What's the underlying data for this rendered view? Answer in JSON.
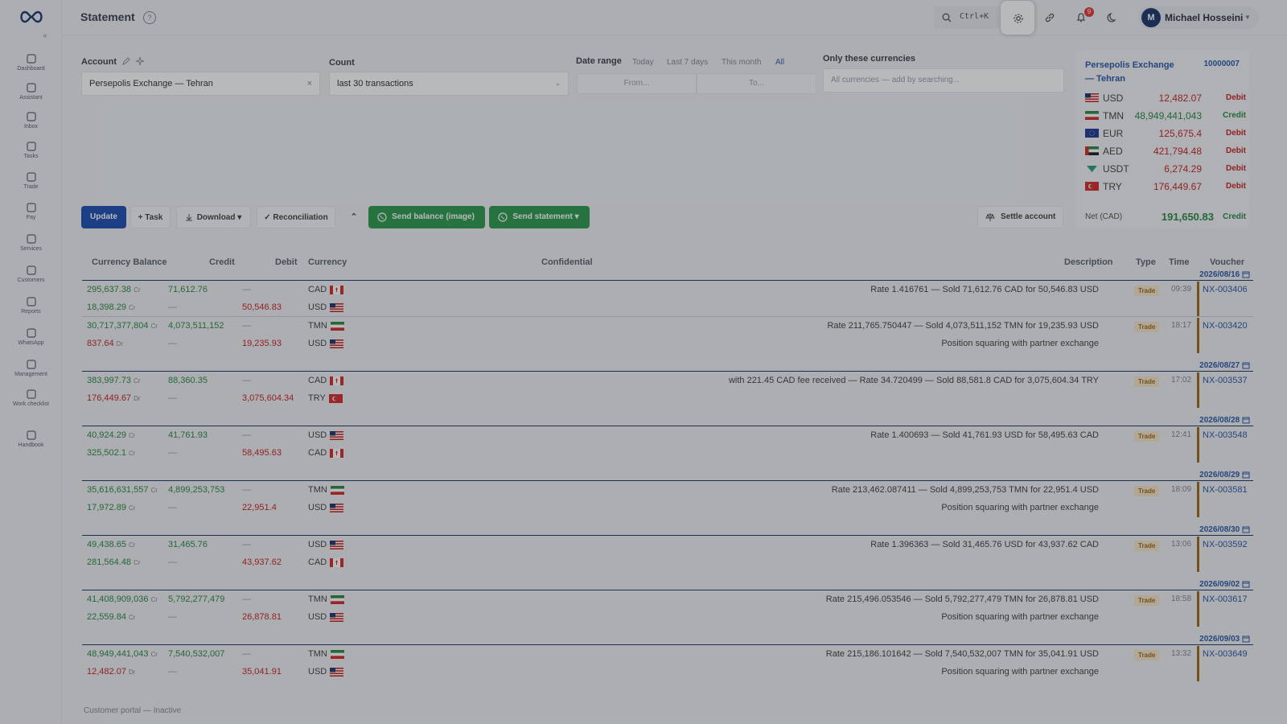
{
  "app": {
    "title": "Statement"
  },
  "topbar": {
    "search_shortcut": "Ctrl+K",
    "notif_count": "9",
    "user_initial": "M",
    "user_name": "Michael Hosseini"
  },
  "sidebar": {
    "items": [
      {
        "label": "Dashboard",
        "icon": "grid-icon"
      },
      {
        "label": "Assistant",
        "icon": "sparkle-icon"
      },
      {
        "label": "Inbox",
        "icon": "mail-icon"
      },
      {
        "label": "Tasks",
        "icon": "check-icon"
      },
      {
        "label": "Trade",
        "icon": "arrows-icon"
      },
      {
        "label": "Pay",
        "icon": "wallet-icon"
      },
      {
        "label": "Services",
        "icon": "bolt-icon"
      },
      {
        "label": "Customers",
        "icon": "users-icon"
      },
      {
        "label": "Reports",
        "icon": "file-icon"
      },
      {
        "label": "WhatsApp",
        "icon": "chat-icon"
      },
      {
        "label": "Management",
        "icon": "sliders-icon"
      },
      {
        "label": "Work checklist",
        "icon": "check-icon"
      },
      {
        "label": "Handbook",
        "icon": "book-icon"
      }
    ]
  },
  "filters": {
    "account_label": "Account",
    "account_value": "Persepolis Exchange — Tehran",
    "count_label": "Count",
    "count_value": "last 30 transactions",
    "date_range_label": "Date range",
    "date_options": [
      "Today",
      "Last 7 days",
      "This month",
      "All"
    ],
    "date_from_placeholder": "From...",
    "date_to_placeholder": "To...",
    "currencies_label": "Only these currencies",
    "currencies_placeholder": "All currencies — add by searching..."
  },
  "actions": {
    "update": "Update",
    "task": "+ Task",
    "download": "Download ▾",
    "reconciliation": "✓ Reconciliation",
    "send_balance": "Send balance (image)",
    "send_statement": "Send statement ▾",
    "settle": "Settle account"
  },
  "balance": {
    "account_name": "Persepolis Exchange — Tehran",
    "account_id": "10000007",
    "rows": [
      {
        "code": "USD",
        "amount": "12,482.07",
        "type": "Debit"
      },
      {
        "code": "TMN",
        "amount": "48,949,441,043",
        "type": "Credit"
      },
      {
        "code": "EUR",
        "amount": "125,675.4",
        "type": "Debit"
      },
      {
        "code": "AED",
        "amount": "421,794.48",
        "type": "Debit"
      },
      {
        "code": "USDT",
        "amount": "6,274.29",
        "type": "Debit"
      },
      {
        "code": "TRY",
        "amount": "176,449.67",
        "type": "Debit"
      }
    ],
    "net_label": "Net (CAD)",
    "net_value": "191,650.83",
    "net_type": "Credit"
  },
  "table": {
    "headers": [
      "Currency Balance",
      "Credit",
      "Debit",
      "Currency",
      "Confidential",
      "Description",
      "Type",
      "Time",
      "Voucher"
    ],
    "groups": [
      {
        "date": "2026/08/16",
        "time": "09:39",
        "voucher": "NX-003406",
        "type": "Trade",
        "rows": [
          {
            "bal": "295,637.38",
            "bs": "Cr",
            "credit": "71,612.76",
            "debit": "—",
            "cur": "CAD",
            "desc": "Rate 1.416761 — Sold 71,612.76 CAD for 50,546.83 USD"
          },
          {
            "bal": "18,398.29",
            "bs": "Cr",
            "credit": "—",
            "debit": "50,546.83",
            "cur": "USD",
            "desc": ""
          }
        ]
      },
      {
        "date": "",
        "time": "18:17",
        "voucher": "NX-003420",
        "type": "Trade",
        "rows": [
          {
            "bal": "30,717,377,804",
            "bs": "Cr",
            "credit": "4,073,511,152",
            "debit": "—",
            "cur": "TMN",
            "desc": "Rate 211,765.750447 — Sold 4,073,511,152 TMN for 19,235.93 USD"
          },
          {
            "bal": "837.64",
            "bs": "Dr",
            "credit": "—",
            "debit": "19,235.93",
            "cur": "USD",
            "desc": "Position squaring with partner exchange"
          }
        ]
      },
      {
        "date": "2026/08/27",
        "time": "17:02",
        "voucher": "NX-003537",
        "type": "Trade",
        "rows": [
          {
            "bal": "383,997.73",
            "bs": "Cr",
            "credit": "88,360.35",
            "debit": "—",
            "cur": "CAD",
            "desc": "with 221.45 CAD fee received — Rate 34.720499 — Sold 88,581.8 CAD for 3,075,604.34 TRY"
          },
          {
            "bal": "176,449.67",
            "bs": "Dr",
            "credit": "—",
            "debit": "3,075,604.34",
            "cur": "TRY",
            "desc": ""
          }
        ]
      },
      {
        "date": "2026/08/28",
        "time": "12:41",
        "voucher": "NX-003548",
        "type": "Trade",
        "rows": [
          {
            "bal": "40,924.29",
            "bs": "Cr",
            "credit": "41,761.93",
            "debit": "—",
            "cur": "USD",
            "desc": "Rate 1.400693 — Sold 41,761.93 USD for 58,495.63 CAD"
          },
          {
            "bal": "325,502.1",
            "bs": "Cr",
            "credit": "—",
            "debit": "58,495.63",
            "cur": "CAD",
            "desc": ""
          }
        ]
      },
      {
        "date": "2026/08/29",
        "time": "18:09",
        "voucher": "NX-003581",
        "type": "Trade",
        "rows": [
          {
            "bal": "35,616,631,557",
            "bs": "Cr",
            "credit": "4,899,253,753",
            "debit": "—",
            "cur": "TMN",
            "desc": "Rate 213,462.087411 — Sold 4,899,253,753 TMN for 22,951.4 USD"
          },
          {
            "bal": "17,972.89",
            "bs": "Cr",
            "credit": "—",
            "debit": "22,951.4",
            "cur": "USD",
            "desc": "Position squaring with partner exchange"
          }
        ]
      },
      {
        "date": "2026/08/30",
        "time": "13:06",
        "voucher": "NX-003592",
        "type": "Trade",
        "rows": [
          {
            "bal": "49,438.65",
            "bs": "Cr",
            "credit": "31,465.76",
            "debit": "—",
            "cur": "USD",
            "desc": "Rate 1.396363 — Sold 31,465.76 USD for 43,937.62 CAD"
          },
          {
            "bal": "281,564.48",
            "bs": "Cr",
            "credit": "—",
            "debit": "43,937.62",
            "cur": "CAD",
            "desc": ""
          }
        ]
      },
      {
        "date": "2026/09/02",
        "time": "18:58",
        "voucher": "NX-003617",
        "type": "Trade",
        "rows": [
          {
            "bal": "41,408,909,036",
            "bs": "Cr",
            "credit": "5,792,277,479",
            "debit": "—",
            "cur": "TMN",
            "desc": "Rate 215,496.053546 — Sold 5,792,277,479 TMN for 26,878.81 USD"
          },
          {
            "bal": "22,559.84",
            "bs": "Cr",
            "credit": "—",
            "debit": "26,878.81",
            "cur": "USD",
            "desc": "Position squaring with partner exchange"
          }
        ]
      },
      {
        "date": "2026/09/03",
        "time": "13:32",
        "voucher": "NX-003649",
        "type": "Trade",
        "rows": [
          {
            "bal": "48,949,441,043",
            "bs": "Cr",
            "credit": "7,540,532,007",
            "debit": "—",
            "cur": "TMN",
            "desc": "Rate 215,186.101642 — Sold 7,540,532,007 TMN for 35,041.91 USD"
          },
          {
            "bal": "12,482.07",
            "bs": "Dr",
            "credit": "—",
            "debit": "35,041.91",
            "cur": "USD",
            "desc": "Position squaring with partner exchange"
          }
        ]
      }
    ]
  },
  "footer": {
    "portal": "Customer portal — Inactive"
  },
  "colors": {
    "brand": "#1f4fb0",
    "credit": "#2e8a46",
    "debit": "#c62828",
    "whatsapp": "#2e9b4f"
  }
}
